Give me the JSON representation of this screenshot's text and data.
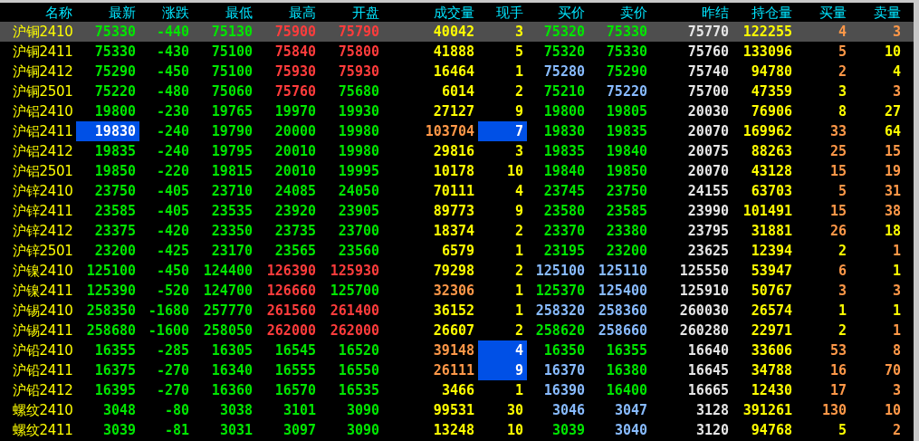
{
  "table": {
    "columns": [
      "名称",
      "最新",
      "涨跌",
      "最低",
      "最高",
      "开盘",
      "成交量",
      "现手",
      "买价",
      "卖价",
      "昨结",
      "持仓量",
      "买量",
      "卖量"
    ],
    "rows": [
      {
        "selected": true,
        "cells": [
          {
            "text": "沪铜2410",
            "color": "#ffff00"
          },
          {
            "text": "75330",
            "color": "#00e600"
          },
          {
            "text": "-440",
            "color": "#00e600"
          },
          {
            "text": "75130",
            "color": "#00e600"
          },
          {
            "text": "75900",
            "color": "#ff3c3c"
          },
          {
            "text": "75790",
            "color": "#ff3c3c"
          },
          {
            "text": "40042",
            "color": "#ffff00"
          },
          {
            "text": "3",
            "color": "#ffff00"
          },
          {
            "text": "75320",
            "color": "#00e600"
          },
          {
            "text": "75330",
            "color": "#00e600"
          },
          {
            "text": "75770",
            "color": "#e6e6e6"
          },
          {
            "text": "122255",
            "color": "#ffff00"
          },
          {
            "text": "4",
            "color": "#ff9848"
          },
          {
            "text": "3",
            "color": "#ff9848"
          }
        ]
      },
      {
        "selected": false,
        "cells": [
          {
            "text": "沪铜2411",
            "color": "#ffff00"
          },
          {
            "text": "75330",
            "color": "#00e600"
          },
          {
            "text": "-430",
            "color": "#00e600"
          },
          {
            "text": "75100",
            "color": "#00e600"
          },
          {
            "text": "75840",
            "color": "#ff3c3c"
          },
          {
            "text": "75800",
            "color": "#ff3c3c"
          },
          {
            "text": "41888",
            "color": "#ffff00"
          },
          {
            "text": "5",
            "color": "#ffff00"
          },
          {
            "text": "75320",
            "color": "#00e600"
          },
          {
            "text": "75330",
            "color": "#00e600"
          },
          {
            "text": "75760",
            "color": "#e6e6e6"
          },
          {
            "text": "133096",
            "color": "#ffff00"
          },
          {
            "text": "5",
            "color": "#ff9848"
          },
          {
            "text": "10",
            "color": "#ffff00"
          }
        ]
      },
      {
        "selected": false,
        "cells": [
          {
            "text": "沪铜2412",
            "color": "#ffff00"
          },
          {
            "text": "75290",
            "color": "#00e600"
          },
          {
            "text": "-450",
            "color": "#00e600"
          },
          {
            "text": "75100",
            "color": "#00e600"
          },
          {
            "text": "75930",
            "color": "#ff3c3c"
          },
          {
            "text": "75930",
            "color": "#ff3c3c"
          },
          {
            "text": "16464",
            "color": "#ffff00"
          },
          {
            "text": "1",
            "color": "#ffff00"
          },
          {
            "text": "75280",
            "color": "#88bbff"
          },
          {
            "text": "75290",
            "color": "#00e600"
          },
          {
            "text": "75740",
            "color": "#e6e6e6"
          },
          {
            "text": "94780",
            "color": "#ffff00"
          },
          {
            "text": "2",
            "color": "#ff9848"
          },
          {
            "text": "4",
            "color": "#ffff00"
          }
        ]
      },
      {
        "selected": false,
        "cells": [
          {
            "text": "沪铜2501",
            "color": "#ffff00"
          },
          {
            "text": "75220",
            "color": "#00e600"
          },
          {
            "text": "-480",
            "color": "#00e600"
          },
          {
            "text": "75060",
            "color": "#00e600"
          },
          {
            "text": "75760",
            "color": "#ff3c3c"
          },
          {
            "text": "75680",
            "color": "#00e600"
          },
          {
            "text": "6014",
            "color": "#ffff00"
          },
          {
            "text": "2",
            "color": "#ffff00"
          },
          {
            "text": "75210",
            "color": "#00e600"
          },
          {
            "text": "75220",
            "color": "#88bbff"
          },
          {
            "text": "75700",
            "color": "#e6e6e6"
          },
          {
            "text": "47359",
            "color": "#ffff00"
          },
          {
            "text": "3",
            "color": "#ffff00"
          },
          {
            "text": "3",
            "color": "#ff9848"
          }
        ]
      },
      {
        "selected": false,
        "cells": [
          {
            "text": "沪铝2410",
            "color": "#ffff00"
          },
          {
            "text": "19800",
            "color": "#00e600"
          },
          {
            "text": "-230",
            "color": "#00e600"
          },
          {
            "text": "19765",
            "color": "#00e600"
          },
          {
            "text": "19970",
            "color": "#00e600"
          },
          {
            "text": "19930",
            "color": "#00e600"
          },
          {
            "text": "27127",
            "color": "#ffff00"
          },
          {
            "text": "9",
            "color": "#ffff00"
          },
          {
            "text": "19800",
            "color": "#00e600"
          },
          {
            "text": "19805",
            "color": "#00e600"
          },
          {
            "text": "20030",
            "color": "#e6e6e6"
          },
          {
            "text": "76906",
            "color": "#ffff00"
          },
          {
            "text": "8",
            "color": "#ffff00"
          },
          {
            "text": "27",
            "color": "#ffff00"
          }
        ]
      },
      {
        "selected": false,
        "cells": [
          {
            "text": "沪铝2411",
            "color": "#ffff00"
          },
          {
            "text": "19830",
            "color": "#ffffff",
            "highlighted": true
          },
          {
            "text": "-240",
            "color": "#00e600"
          },
          {
            "text": "19790",
            "color": "#00e600"
          },
          {
            "text": "20000",
            "color": "#00e600"
          },
          {
            "text": "19980",
            "color": "#00e600"
          },
          {
            "text": "103704",
            "color": "#ff9848"
          },
          {
            "text": "7",
            "color": "#ffffff",
            "highlighted": true
          },
          {
            "text": "19830",
            "color": "#00e600"
          },
          {
            "text": "19835",
            "color": "#00e600"
          },
          {
            "text": "20070",
            "color": "#e6e6e6"
          },
          {
            "text": "169962",
            "color": "#ffff00"
          },
          {
            "text": "33",
            "color": "#ff9848"
          },
          {
            "text": "64",
            "color": "#ffff00"
          }
        ]
      },
      {
        "selected": false,
        "cells": [
          {
            "text": "沪铝2412",
            "color": "#ffff00"
          },
          {
            "text": "19835",
            "color": "#00e600"
          },
          {
            "text": "-240",
            "color": "#00e600"
          },
          {
            "text": "19795",
            "color": "#00e600"
          },
          {
            "text": "20010",
            "color": "#00e600"
          },
          {
            "text": "19980",
            "color": "#00e600"
          },
          {
            "text": "29816",
            "color": "#ffff00"
          },
          {
            "text": "3",
            "color": "#ffff00"
          },
          {
            "text": "19835",
            "color": "#00e600"
          },
          {
            "text": "19840",
            "color": "#00e600"
          },
          {
            "text": "20075",
            "color": "#e6e6e6"
          },
          {
            "text": "88263",
            "color": "#ffff00"
          },
          {
            "text": "25",
            "color": "#ff9848"
          },
          {
            "text": "15",
            "color": "#ff9848"
          }
        ]
      },
      {
        "selected": false,
        "cells": [
          {
            "text": "沪铝2501",
            "color": "#ffff00"
          },
          {
            "text": "19850",
            "color": "#00e600"
          },
          {
            "text": "-220",
            "color": "#00e600"
          },
          {
            "text": "19815",
            "color": "#00e600"
          },
          {
            "text": "20010",
            "color": "#00e600"
          },
          {
            "text": "19995",
            "color": "#00e600"
          },
          {
            "text": "10178",
            "color": "#ffff00"
          },
          {
            "text": "10",
            "color": "#ffff00"
          },
          {
            "text": "19840",
            "color": "#00e600"
          },
          {
            "text": "19850",
            "color": "#00e600"
          },
          {
            "text": "20070",
            "color": "#e6e6e6"
          },
          {
            "text": "43128",
            "color": "#ffff00"
          },
          {
            "text": "15",
            "color": "#ff9848"
          },
          {
            "text": "19",
            "color": "#ff9848"
          }
        ]
      },
      {
        "selected": false,
        "cells": [
          {
            "text": "沪锌2410",
            "color": "#ffff00"
          },
          {
            "text": "23750",
            "color": "#00e600"
          },
          {
            "text": "-405",
            "color": "#00e600"
          },
          {
            "text": "23710",
            "color": "#00e600"
          },
          {
            "text": "24085",
            "color": "#00e600"
          },
          {
            "text": "24050",
            "color": "#00e600"
          },
          {
            "text": "70111",
            "color": "#ffff00"
          },
          {
            "text": "4",
            "color": "#ffff00"
          },
          {
            "text": "23745",
            "color": "#00e600"
          },
          {
            "text": "23750",
            "color": "#00e600"
          },
          {
            "text": "24155",
            "color": "#e6e6e6"
          },
          {
            "text": "63703",
            "color": "#ffff00"
          },
          {
            "text": "5",
            "color": "#ff9848"
          },
          {
            "text": "31",
            "color": "#ff9848"
          }
        ]
      },
      {
        "selected": false,
        "cells": [
          {
            "text": "沪锌2411",
            "color": "#ffff00"
          },
          {
            "text": "23585",
            "color": "#00e600"
          },
          {
            "text": "-405",
            "color": "#00e600"
          },
          {
            "text": "23535",
            "color": "#00e600"
          },
          {
            "text": "23920",
            "color": "#00e600"
          },
          {
            "text": "23905",
            "color": "#00e600"
          },
          {
            "text": "89773",
            "color": "#ffff00"
          },
          {
            "text": "9",
            "color": "#ffff00"
          },
          {
            "text": "23580",
            "color": "#00e600"
          },
          {
            "text": "23585",
            "color": "#00e600"
          },
          {
            "text": "23990",
            "color": "#e6e6e6"
          },
          {
            "text": "101491",
            "color": "#ffff00"
          },
          {
            "text": "15",
            "color": "#ff9848"
          },
          {
            "text": "38",
            "color": "#ff9848"
          }
        ]
      },
      {
        "selected": false,
        "cells": [
          {
            "text": "沪锌2412",
            "color": "#ffff00"
          },
          {
            "text": "23375",
            "color": "#00e600"
          },
          {
            "text": "-420",
            "color": "#00e600"
          },
          {
            "text": "23350",
            "color": "#00e600"
          },
          {
            "text": "23735",
            "color": "#00e600"
          },
          {
            "text": "23700",
            "color": "#00e600"
          },
          {
            "text": "18374",
            "color": "#ffff00"
          },
          {
            "text": "2",
            "color": "#ffff00"
          },
          {
            "text": "23370",
            "color": "#00e600"
          },
          {
            "text": "23380",
            "color": "#00e600"
          },
          {
            "text": "23795",
            "color": "#e6e6e6"
          },
          {
            "text": "31881",
            "color": "#ffff00"
          },
          {
            "text": "26",
            "color": "#ff9848"
          },
          {
            "text": "18",
            "color": "#ffff00"
          }
        ]
      },
      {
        "selected": false,
        "cells": [
          {
            "text": "沪锌2501",
            "color": "#ffff00"
          },
          {
            "text": "23200",
            "color": "#00e600"
          },
          {
            "text": "-425",
            "color": "#00e600"
          },
          {
            "text": "23170",
            "color": "#00e600"
          },
          {
            "text": "23565",
            "color": "#00e600"
          },
          {
            "text": "23560",
            "color": "#00e600"
          },
          {
            "text": "6579",
            "color": "#ffff00"
          },
          {
            "text": "1",
            "color": "#ffff00"
          },
          {
            "text": "23195",
            "color": "#00e600"
          },
          {
            "text": "23200",
            "color": "#00e600"
          },
          {
            "text": "23625",
            "color": "#e6e6e6"
          },
          {
            "text": "12394",
            "color": "#ffff00"
          },
          {
            "text": "2",
            "color": "#ffff00"
          },
          {
            "text": "1",
            "color": "#ff9848"
          }
        ]
      },
      {
        "selected": false,
        "cells": [
          {
            "text": "沪镍2410",
            "color": "#ffff00"
          },
          {
            "text": "125100",
            "color": "#00e600"
          },
          {
            "text": "-450",
            "color": "#00e600"
          },
          {
            "text": "124400",
            "color": "#00e600"
          },
          {
            "text": "126390",
            "color": "#ff3c3c"
          },
          {
            "text": "125930",
            "color": "#ff3c3c"
          },
          {
            "text": "79298",
            "color": "#ffff00"
          },
          {
            "text": "2",
            "color": "#ffff00"
          },
          {
            "text": "125100",
            "color": "#88bbff"
          },
          {
            "text": "125110",
            "color": "#88bbff"
          },
          {
            "text": "125550",
            "color": "#e6e6e6"
          },
          {
            "text": "53947",
            "color": "#ffff00"
          },
          {
            "text": "6",
            "color": "#ff9848"
          },
          {
            "text": "1",
            "color": "#ffff00"
          }
        ]
      },
      {
        "selected": false,
        "cells": [
          {
            "text": "沪镍2411",
            "color": "#ffff00"
          },
          {
            "text": "125390",
            "color": "#00e600"
          },
          {
            "text": "-520",
            "color": "#00e600"
          },
          {
            "text": "124700",
            "color": "#00e600"
          },
          {
            "text": "126660",
            "color": "#ff3c3c"
          },
          {
            "text": "125700",
            "color": "#00e600"
          },
          {
            "text": "32306",
            "color": "#ff9848"
          },
          {
            "text": "1",
            "color": "#ffff00"
          },
          {
            "text": "125370",
            "color": "#00e600"
          },
          {
            "text": "125400",
            "color": "#88bbff"
          },
          {
            "text": "125910",
            "color": "#e6e6e6"
          },
          {
            "text": "50767",
            "color": "#ffff00"
          },
          {
            "text": "3",
            "color": "#ff9848"
          },
          {
            "text": "3",
            "color": "#ff9848"
          }
        ]
      },
      {
        "selected": false,
        "cells": [
          {
            "text": "沪锡2410",
            "color": "#ffff00"
          },
          {
            "text": "258350",
            "color": "#00e600"
          },
          {
            "text": "-1680",
            "color": "#00e600"
          },
          {
            "text": "257770",
            "color": "#00e600"
          },
          {
            "text": "261560",
            "color": "#ff3c3c"
          },
          {
            "text": "261400",
            "color": "#ff3c3c"
          },
          {
            "text": "36152",
            "color": "#ffff00"
          },
          {
            "text": "1",
            "color": "#ffff00"
          },
          {
            "text": "258320",
            "color": "#88bbff"
          },
          {
            "text": "258360",
            "color": "#88bbff"
          },
          {
            "text": "260030",
            "color": "#e6e6e6"
          },
          {
            "text": "26574",
            "color": "#ffff00"
          },
          {
            "text": "1",
            "color": "#ffff00"
          },
          {
            "text": "1",
            "color": "#ffff00"
          }
        ]
      },
      {
        "selected": false,
        "cells": [
          {
            "text": "沪锡2411",
            "color": "#ffff00"
          },
          {
            "text": "258680",
            "color": "#00e600"
          },
          {
            "text": "-1600",
            "color": "#00e600"
          },
          {
            "text": "258050",
            "color": "#00e600"
          },
          {
            "text": "262000",
            "color": "#ff3c3c"
          },
          {
            "text": "262000",
            "color": "#ff3c3c"
          },
          {
            "text": "26607",
            "color": "#ffff00"
          },
          {
            "text": "2",
            "color": "#ffff00"
          },
          {
            "text": "258620",
            "color": "#00e600"
          },
          {
            "text": "258660",
            "color": "#88bbff"
          },
          {
            "text": "260280",
            "color": "#e6e6e6"
          },
          {
            "text": "22971",
            "color": "#ffff00"
          },
          {
            "text": "2",
            "color": "#ffff00"
          },
          {
            "text": "1",
            "color": "#ff9848"
          }
        ]
      },
      {
        "selected": false,
        "cells": [
          {
            "text": "沪铅2410",
            "color": "#ffff00"
          },
          {
            "text": "16355",
            "color": "#00e600"
          },
          {
            "text": "-285",
            "color": "#00e600"
          },
          {
            "text": "16305",
            "color": "#00e600"
          },
          {
            "text": "16545",
            "color": "#00e600"
          },
          {
            "text": "16520",
            "color": "#00e600"
          },
          {
            "text": "39148",
            "color": "#ff9848"
          },
          {
            "text": "4",
            "color": "#ffffff",
            "highlighted": true
          },
          {
            "text": "16350",
            "color": "#00e600"
          },
          {
            "text": "16355",
            "color": "#00e600"
          },
          {
            "text": "16640",
            "color": "#e6e6e6"
          },
          {
            "text": "33606",
            "color": "#ffff00"
          },
          {
            "text": "53",
            "color": "#ff9848"
          },
          {
            "text": "8",
            "color": "#ff9848"
          }
        ]
      },
      {
        "selected": false,
        "cells": [
          {
            "text": "沪铅2411",
            "color": "#ffff00"
          },
          {
            "text": "16375",
            "color": "#00e600"
          },
          {
            "text": "-270",
            "color": "#00e600"
          },
          {
            "text": "16340",
            "color": "#00e600"
          },
          {
            "text": "16555",
            "color": "#00e600"
          },
          {
            "text": "16550",
            "color": "#00e600"
          },
          {
            "text": "26111",
            "color": "#ff9848"
          },
          {
            "text": "9",
            "color": "#ffffff",
            "highlighted": true
          },
          {
            "text": "16370",
            "color": "#88bbff"
          },
          {
            "text": "16380",
            "color": "#00e600"
          },
          {
            "text": "16645",
            "color": "#e6e6e6"
          },
          {
            "text": "34788",
            "color": "#ffff00"
          },
          {
            "text": "16",
            "color": "#ff9848"
          },
          {
            "text": "70",
            "color": "#ff9848"
          }
        ]
      },
      {
        "selected": false,
        "cells": [
          {
            "text": "沪铅2412",
            "color": "#ffff00"
          },
          {
            "text": "16395",
            "color": "#00e600"
          },
          {
            "text": "-270",
            "color": "#00e600"
          },
          {
            "text": "16360",
            "color": "#00e600"
          },
          {
            "text": "16570",
            "color": "#00e600"
          },
          {
            "text": "16535",
            "color": "#00e600"
          },
          {
            "text": "3466",
            "color": "#ffff00"
          },
          {
            "text": "1",
            "color": "#ffff00"
          },
          {
            "text": "16390",
            "color": "#88bbff"
          },
          {
            "text": "16400",
            "color": "#00e600"
          },
          {
            "text": "16665",
            "color": "#e6e6e6"
          },
          {
            "text": "12430",
            "color": "#ffff00"
          },
          {
            "text": "17",
            "color": "#ff9848"
          },
          {
            "text": "3",
            "color": "#ff9848"
          }
        ]
      },
      {
        "selected": false,
        "cells": [
          {
            "text": "螺纹2410",
            "color": "#ffff00"
          },
          {
            "text": "3048",
            "color": "#00e600"
          },
          {
            "text": "-80",
            "color": "#00e600"
          },
          {
            "text": "3038",
            "color": "#00e600"
          },
          {
            "text": "3101",
            "color": "#00e600"
          },
          {
            "text": "3090",
            "color": "#00e600"
          },
          {
            "text": "99531",
            "color": "#ffff00"
          },
          {
            "text": "30",
            "color": "#ffff00"
          },
          {
            "text": "3046",
            "color": "#88bbff"
          },
          {
            "text": "3047",
            "color": "#88bbff"
          },
          {
            "text": "3128",
            "color": "#e6e6e6"
          },
          {
            "text": "391261",
            "color": "#ffff00"
          },
          {
            "text": "130",
            "color": "#ff9848"
          },
          {
            "text": "10",
            "color": "#ff9848"
          }
        ]
      },
      {
        "selected": false,
        "cells": [
          {
            "text": "螺纹2411",
            "color": "#ffff00"
          },
          {
            "text": "3039",
            "color": "#00e600"
          },
          {
            "text": "-81",
            "color": "#00e600"
          },
          {
            "text": "3031",
            "color": "#00e600"
          },
          {
            "text": "3097",
            "color": "#00e600"
          },
          {
            "text": "3090",
            "color": "#00e600"
          },
          {
            "text": "13248",
            "color": "#ffff00"
          },
          {
            "text": "10",
            "color": "#ffff00"
          },
          {
            "text": "3039",
            "color": "#00e600"
          },
          {
            "text": "3040",
            "color": "#88bbff"
          },
          {
            "text": "3120",
            "color": "#e6e6e6"
          },
          {
            "text": "94768",
            "color": "#ffff00"
          },
          {
            "text": "5",
            "color": "#ffff00"
          },
          {
            "text": "2",
            "color": "#ff9848"
          }
        ]
      }
    ]
  }
}
